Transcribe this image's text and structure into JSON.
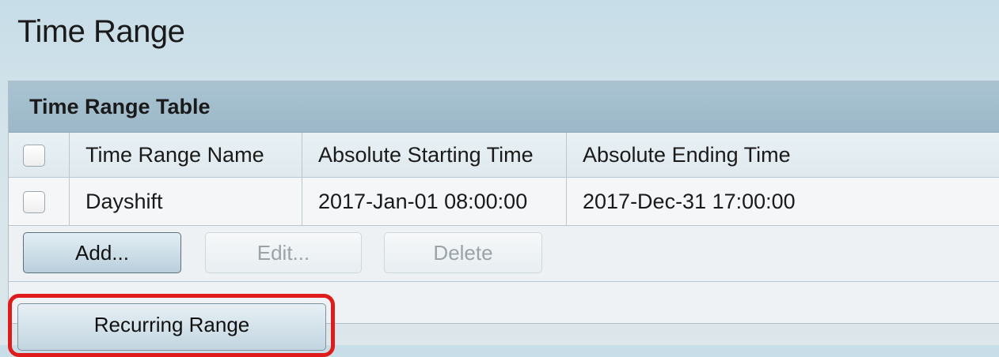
{
  "page": {
    "title": "Time Range"
  },
  "table": {
    "caption": "Time Range Table",
    "columns": [
      "Time Range Name",
      "Absolute Starting Time",
      "Absolute Ending Time"
    ],
    "rows": [
      {
        "name": "Dayshift",
        "start": "2017-Jan-01 08:00:00",
        "end": "2017-Dec-31 17:00:00",
        "checked": false
      }
    ]
  },
  "buttons": {
    "add": "Add...",
    "edit": "Edit...",
    "delete": "Delete",
    "recurring": "Recurring Range"
  },
  "colors": {
    "highlight": "#e01b1b",
    "header_bar": "#a9c3d1"
  }
}
